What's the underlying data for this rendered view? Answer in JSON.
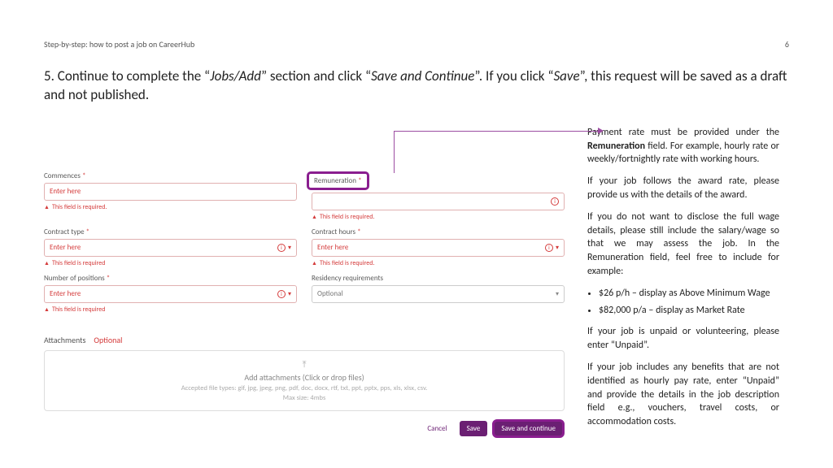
{
  "header": {
    "title": "Step-by-step: how to post a job on CareerHub",
    "page": "6"
  },
  "instruction": {
    "pre": "5. Continue to complete the “",
    "i1": "Jobs/Add",
    "mid1": "” section and click “",
    "i2": "Save and Continue",
    "mid2": "”. If you click “",
    "i3": "Save",
    "post": "”, this request will be saved as a draft and not published."
  },
  "form": {
    "commences": {
      "label": "Commences",
      "ph": "Enter here",
      "err": "This field is required."
    },
    "remuneration": {
      "label": "Remuneration",
      "err": "This field is required."
    },
    "contract_type": {
      "label": "Contract type",
      "ph": "Enter here",
      "err": "This field is required"
    },
    "contract_hours": {
      "label": "Contract hours",
      "ph": "Enter here",
      "err": "This field is required."
    },
    "num_positions": {
      "label": "Number of positions",
      "ph": "Enter here",
      "err": "This field is required"
    },
    "residency": {
      "label": "Residency requirements",
      "ph": "Optional"
    },
    "attachments": {
      "label": "Attachments",
      "badge": "Optional"
    },
    "drop": {
      "l1": "Add attachments (Click or drop files)",
      "l2": "Accepted file types: gif, jpg, jpeg, png, pdf, doc, docx, rtf, txt, ppt, pptx, pps, xls, xlsx, csv.",
      "l3": "Max size: 4mbs"
    },
    "buttons": {
      "cancel": "Cancel",
      "save": "Save",
      "save_continue": "Save and continue"
    }
  },
  "sidebar": {
    "p1a": "Payment rate must be provided under the ",
    "p1b": "Remuneration",
    "p1c": " field. For example, hourly rate or weekly/fortnightly rate with working hours.",
    "p2": "If your job follows the award rate, please provide us with the details of the award.",
    "p3": "If you do not want to disclose the full wage details, please still include the salary/wage so that we may assess the job. In the Remuneration field, feel free to include for example:",
    "li1": "$26 p/h – display as Above Minimum Wage",
    "li2": "$82,000 p/a – display as Market Rate",
    "p4": "If your job is unpaid or volunteering, please enter “Unpaid”.",
    "p5": "If your job includes any benefits that are not identified as hourly pay rate, enter “Unpaid” and provide the details in the job description field e.g., vouchers, travel costs, or accommodation costs."
  }
}
